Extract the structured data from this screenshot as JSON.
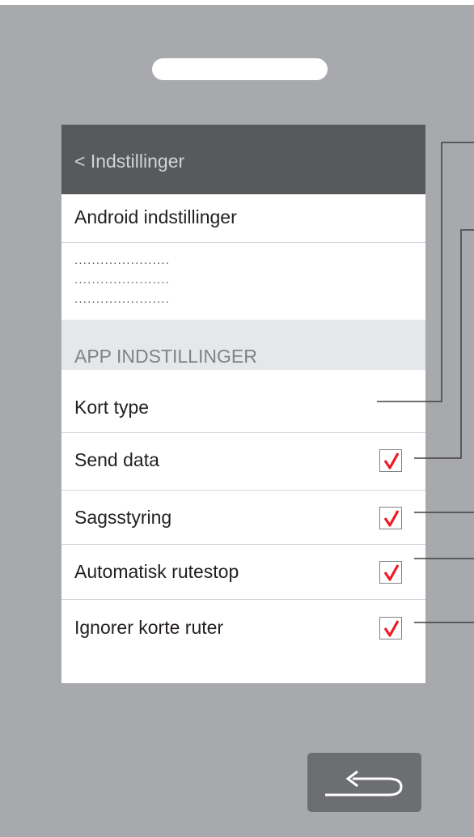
{
  "header": {
    "title": "< Indstillinger"
  },
  "android_settings": {
    "label": "Android indstillinger",
    "placeholder_lines": [
      "......................",
      "......................",
      "......................"
    ]
  },
  "app_settings": {
    "section_label": "APP INDSTILLINGER",
    "items": [
      {
        "label": "Kort type",
        "has_checkbox": false
      },
      {
        "label": "Send data",
        "has_checkbox": true,
        "checked": true
      },
      {
        "label": "Sagsstyring",
        "has_checkbox": true,
        "checked": true
      },
      {
        "label": "Automatisk rutestop",
        "has_checkbox": true,
        "checked": true
      },
      {
        "label": "Ignorer korte ruter",
        "has_checkbox": true,
        "checked": true
      }
    ]
  },
  "icons": {
    "checkmark": "checkmark-icon",
    "back": "back-arrow-icon"
  },
  "colors": {
    "background": "#a7a9ac",
    "title_bar": "#58595b",
    "section": "#e6e7e8",
    "check": "#ed1c24",
    "back_button": "#6d6e71"
  }
}
